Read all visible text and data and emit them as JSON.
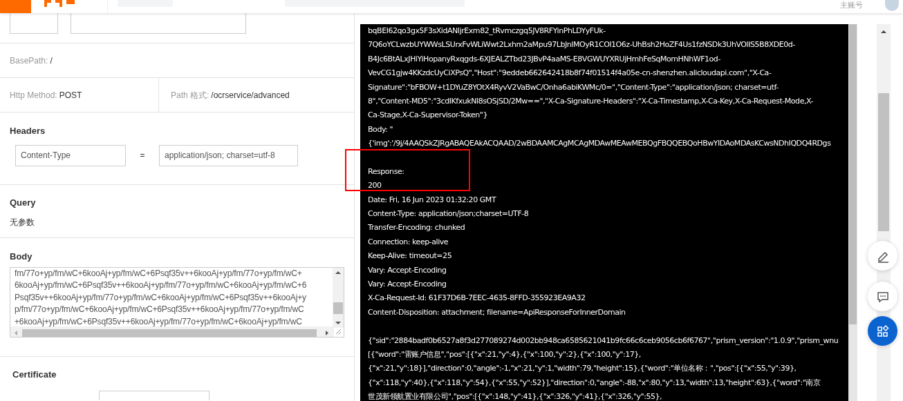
{
  "header": {
    "account": "主账号"
  },
  "api_info": {
    "base_path_label": "BasePath:",
    "base_path": "/",
    "method_label": "Http Method:",
    "method": "POST",
    "path_label": "Path 格式:",
    "path": "/ocrservice/advanced"
  },
  "headers": {
    "title": "Headers",
    "rows": [
      {
        "name": "Content-Type",
        "equals": "=",
        "value": "application/json; charset=utf-8"
      }
    ]
  },
  "query": {
    "title": "Query",
    "empty_text": "无参数"
  },
  "body": {
    "title": "Body",
    "lines": [
      "fm/77o+yp/fm/wC+6kooAj+yp/fm/wC+6Psqf35v++6kooAj+yp/fm/77o+yp/fm/wC+",
      "6kooAj+yp/fm/wC+6Psqf35v++6kooAj+yp/fm/77o+yp/fm/wC+6kooAj+yp/fm/wC+6",
      "Psqf35v++6kooAj+yp/fm/77o+yp/fm/wC+6kooAj+yp/fm/wC+6Psqf35v++6kooAj+y",
      "p/fm/77o+yp/fm/wC+6kooAj+yp/fm/wC+6Psqf35v++6kooAj+yp/fm/77o+yp/fm/wC",
      "+6kooAj+yp/fm/wC+6Psqf35v++6kooAj+yp/fm/77o+yp/fm/wC+6kooAj+yp/fm/wC"
    ]
  },
  "certificate": {
    "title": "Certificate"
  },
  "console": {
    "blocks": [
      [
        "bqBEI62qo3gx5F3sXidANIjrExm82_tRvmczgq5JV8RFYinPhLDYyFUk-",
        "7Q6oYCLwzbUYWWsLSUrxFvWLiWwt2Lxhm2aMpu97LbJnlMOyR1COl1O6z-UhBsh2HoZF4Us1fzNSDk3UhVOlIS5B8XDE0d-",
        "B4Jc6BtALxJHiYiHopanyRxqgds-6XJEALZTbd23JBvP4aaMS-E8VGWUYXRUjHmhFeSqMomHNhWF1od-",
        "VevCG1gjw4KKzdcUyCiXPsQ\",\"Host\":\"9eddeb662642418b8f74f01514f4a05e-cn-shenzhen.alicloudapi.com\",\"X-Ca-",
        "Signature\":\"bFBOW+t1DYuZ8YOtX4RyvV2VaBwC/Onha6abiKWMc/0=\",\"Content-Type\":\"application/json; charset=utf-",
        "8\",\"Content-MD5\":\"3cdIKfxukNI8sOSjSD/2Mw==\",\"X-Ca-Signature-Headers\":\"X-Ca-Timestamp,X-Ca-Key,X-Ca-Request-Mode,X-",
        "Ca-Stage,X-Ca-Supervisor-Token\"}",
        "Body: \"",
        "{'img':'/9j/4AAQSkZJRgABAQEAkACQAAD/2wBDAAMCAgMCAgMDAwMEAwMEBQgFBQQEBQoHBwYIDAoMDAsKCwsNDhIQDQ4RDgs"
      ],
      [
        "Response:",
        "200",
        "Date: Fri, 16 Jun 2023 01:32:20 GMT",
        "Content-Type: application/json;charset=UTF-8",
        "Transfer-Encoding: chunked",
        "Connection: keep-alive",
        "Keep-Alive: timeout=25",
        "Vary: Accept-Encoding",
        "Vary: Accept-Encoding",
        "X-Ca-Request-Id: 61F37D6B-7EEC-4635-8FFD-355923EA9A32",
        "Content-Disposition: attachment; filename=ApiResponseForInnerDomain"
      ],
      [
        "{\"sid\":\"2884badf0b6527a8f3d277089274d002bb948ca6585621041b9fc66c6ceb9056cb6f6767\",\"prism_version\":\"1.0.9\",\"prism_wnu",
        "[{\"word\":\"雷账户信息\",\"pos\":[{\"x\":21,\"y\":4},{\"x\":100,\"y\":2},{\"x\":100,\"y\":17},",
        "{\"x\":21,\"y\":18}],\"direction\":0,\"angle\":-1,\"x\":21,\"y\":1,\"width\":79,\"height\":15},{\"word\":\"单位名称：\",\"pos\":[{\"x\":55,\"y\":39},",
        "{\"x\":118,\"y\":40},{\"x\":118,\"y\":54},{\"x\":55,\"y\":52}],\"direction\":0,\"angle\":-88,\"x\":80,\"y\":13,\"width\":13,\"height\":63},{\"word\":\"南京",
        "世茂新领航置业有限公司\",\"pos\":[{\"x\":148,\"y\":41},{\"x\":326,\"y\":41},{\"x\":326,\"y\":55},"
      ]
    ]
  }
}
